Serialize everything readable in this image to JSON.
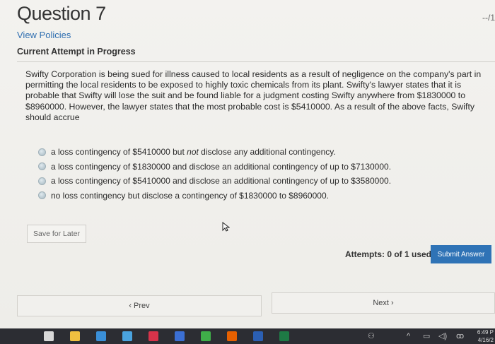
{
  "header": {
    "question_title": "Question 7",
    "score": "--/1",
    "view_policies": "View Policies",
    "attempt_status": "Current Attempt in Progress"
  },
  "question": {
    "text": "Swifty Corporation is being sued for illness caused to local residents as a result of negligence on the company's part in permitting the local residents to be exposed to highly toxic chemicals from its plant. Swifty's lawyer states that it is probable that Swifty will lose the suit and be found liable for a judgment costing Swifty anywhere from $1830000 to $8960000. However, the lawyer states that the most probable cost is $5410000. As a result of the above facts, Swifty should accrue",
    "options": [
      {
        "pre": "a loss contingency of $5410000 but ",
        "em": "not",
        "post": " disclose any additional contingency."
      },
      {
        "pre": "a loss contingency of $1830000 and disclose an additional contingency of up to $7130000.",
        "em": "",
        "post": ""
      },
      {
        "pre": "a loss contingency of $5410000 and disclose an additional contingency of up to $3580000.",
        "em": "",
        "post": ""
      },
      {
        "pre": "no loss contingency but disclose a contingency of $1830000 to $8960000.",
        "em": "",
        "post": ""
      }
    ]
  },
  "actions": {
    "save_for_later": "Save for Later",
    "attempts": "Attempts: 0 of 1 used",
    "submit_answer": "Submit Answer",
    "prev": "‹  Prev",
    "next": "Next  ›"
  },
  "taskbar": {
    "time": "6:49 P",
    "date": "4/16/2",
    "tray_glyph": "ꝏ",
    "icons": [
      {
        "name": "windows-icon",
        "color": "#d8d8d8"
      },
      {
        "name": "file-explorer-icon",
        "color": "#f0c040"
      },
      {
        "name": "store-icon",
        "color": "#3a8fd8"
      },
      {
        "name": "mail-icon",
        "color": "#4aa3df"
      },
      {
        "name": "app-m-icon",
        "color": "#d8334a"
      },
      {
        "name": "app-d-icon",
        "color": "#3b6fd4"
      },
      {
        "name": "chrome-icon",
        "color": "#3fae49"
      },
      {
        "name": "firefox-icon",
        "color": "#e66000"
      },
      {
        "name": "word-icon",
        "color": "#2b5fb3"
      },
      {
        "name": "excel-icon",
        "color": "#1e7a45"
      }
    ]
  }
}
